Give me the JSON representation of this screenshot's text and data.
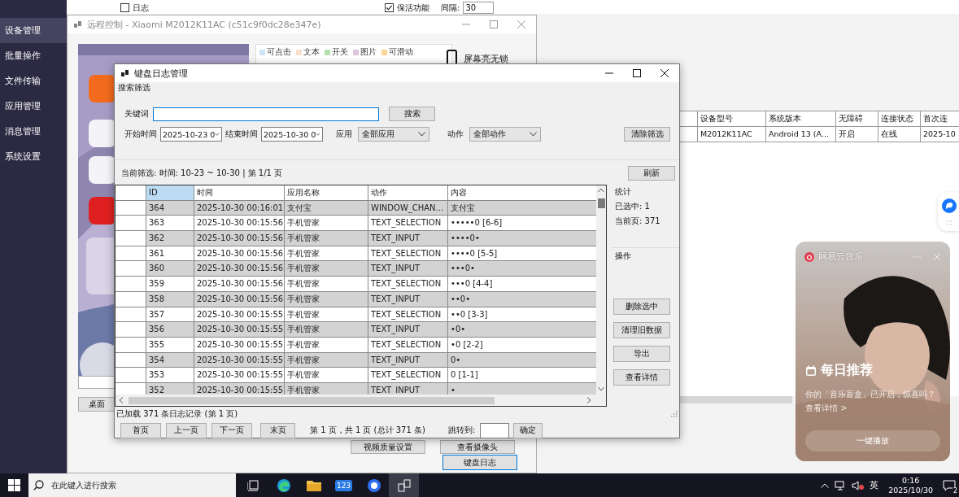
{
  "sidebar": {
    "items": [
      {
        "label": "设备管理",
        "selected": true
      },
      {
        "label": "批量操作",
        "selected": false
      },
      {
        "label": "文件传输",
        "selected": false
      },
      {
        "label": "应用管理",
        "selected": false
      },
      {
        "label": "消息管理",
        "selected": false
      },
      {
        "label": "系统设置",
        "selected": false
      }
    ]
  },
  "options": [
    {
      "label": "日志",
      "checked": false
    },
    {
      "label": "保活功能",
      "checked": true
    }
  ],
  "interval": {
    "label": "间隔:",
    "value": "30"
  },
  "device_table": {
    "columns": [
      "设备型号",
      "系统版本",
      "无障碍",
      "连接状态",
      "首次连"
    ],
    "rows": [
      [
        "M2012K11AC",
        "Android 13 (A...",
        "开启",
        "在线",
        "2025-10"
      ]
    ]
  },
  "remote_window": {
    "title": "远程控制 - Xiaomi M2012K11AC (c51c9f0dc28e347e)",
    "legend": [
      {
        "label": "可点击",
        "color": "#cfe2f3"
      },
      {
        "label": "文本",
        "color": "#fbe0cc"
      },
      {
        "label": "开关",
        "color": "#b6dfb0"
      },
      {
        "label": "图片",
        "color": "#dcc6de"
      },
      {
        "label": "可滑动",
        "color": "#fbd69b"
      }
    ],
    "screen_status": "屏幕亮无锁",
    "home_button": "桌面",
    "buttons": [
      {
        "label": "视频质量设置",
        "selected": false
      },
      {
        "label": "查看摄像头",
        "selected": false
      },
      {
        "label": "键盘日志",
        "selected": true
      }
    ]
  },
  "log_dialog": {
    "title": "键盘日志管理",
    "search_group": "搜索筛选",
    "keyword": {
      "label": "关键词"
    },
    "search_button": "搜索",
    "start": {
      "label": "开始时间",
      "value": "2025-10-23 0"
    },
    "end": {
      "label": "结束时间",
      "value": "2025-10-30 0"
    },
    "app": {
      "label": "应用",
      "value": "全部应用"
    },
    "action": {
      "label": "动作",
      "value": "全部动作"
    },
    "clear_button": "清除筛选",
    "current_filter": "当前筛选: 时间: 10-23 ~ 10-30 | 第 1/1 页",
    "refresh_button": "刷新",
    "table": {
      "columns": [
        {
          "label": "ID",
          "selected": true
        },
        {
          "label": "时间",
          "selected": false
        },
        {
          "label": "应用名称",
          "selected": false
        },
        {
          "label": "动作",
          "selected": false
        },
        {
          "label": "内容",
          "selected": false
        }
      ],
      "rows": [
        [
          "364",
          "2025-10-30 00:16:01",
          "支付宝",
          "WINDOW_CHAN...",
          "支付宝"
        ],
        [
          "363",
          "2025-10-30 00:15:56",
          "手机管家",
          "TEXT_SELECTION",
          "•••••0 [6-6]"
        ],
        [
          "362",
          "2025-10-30 00:15:56",
          "手机管家",
          "TEXT_INPUT",
          "••••0•"
        ],
        [
          "361",
          "2025-10-30 00:15:56",
          "手机管家",
          "TEXT_SELECTION",
          "••••0 [5-5]"
        ],
        [
          "360",
          "2025-10-30 00:15:56",
          "手机管家",
          "TEXT_INPUT",
          "•••0•"
        ],
        [
          "359",
          "2025-10-30 00:15:56",
          "手机管家",
          "TEXT_SELECTION",
          "•••0 [4-4]"
        ],
        [
          "358",
          "2025-10-30 00:15:56",
          "手机管家",
          "TEXT_INPUT",
          "••0•"
        ],
        [
          "357",
          "2025-10-30 00:15:55",
          "手机管家",
          "TEXT_SELECTION",
          "••0 [3-3]"
        ],
        [
          "356",
          "2025-10-30 00:15:55",
          "手机管家",
          "TEXT_INPUT",
          "•0•"
        ],
        [
          "355",
          "2025-10-30 00:15:55",
          "手机管家",
          "TEXT_SELECTION",
          "•0 [2-2]"
        ],
        [
          "354",
          "2025-10-30 00:15:55",
          "手机管家",
          "TEXT_INPUT",
          "0•"
        ],
        [
          "353",
          "2025-10-30 00:15:55",
          "手机管家",
          "TEXT_SELECTION",
          "0 [1-1]"
        ],
        [
          "352",
          "2025-10-30 00:15:55",
          "手机管家",
          "TEXT_INPUT",
          "•"
        ]
      ]
    },
    "stats": {
      "title": "统计",
      "lines": [
        "已选中: 1",
        "当前页: 371"
      ]
    },
    "operations": {
      "title": "操作",
      "buttons": [
        "删除选中",
        "清理旧数据",
        "导出",
        "查看详情"
      ]
    },
    "status": "已加载 371 条日志记录 (第 1 页)",
    "pager": {
      "buttons": [
        "首页",
        "上一页",
        "下一页",
        "末页"
      ],
      "info": "第 1 页，共 1 页 (总计 371 条)",
      "jump_label": "跳转到:",
      "confirm": "确定"
    }
  },
  "notification": {
    "app": "网易云音乐",
    "title": "每日推荐",
    "message": "你的「音乐盲盒」已开启，惊喜吗？",
    "link": "查看详情 >",
    "button": "一键播放"
  },
  "taskbar": {
    "search_placeholder": "在此键入进行搜索",
    "app_label": "123",
    "ime": "英",
    "time": "0:16",
    "date": "2025/10/30",
    "badge": "2"
  }
}
